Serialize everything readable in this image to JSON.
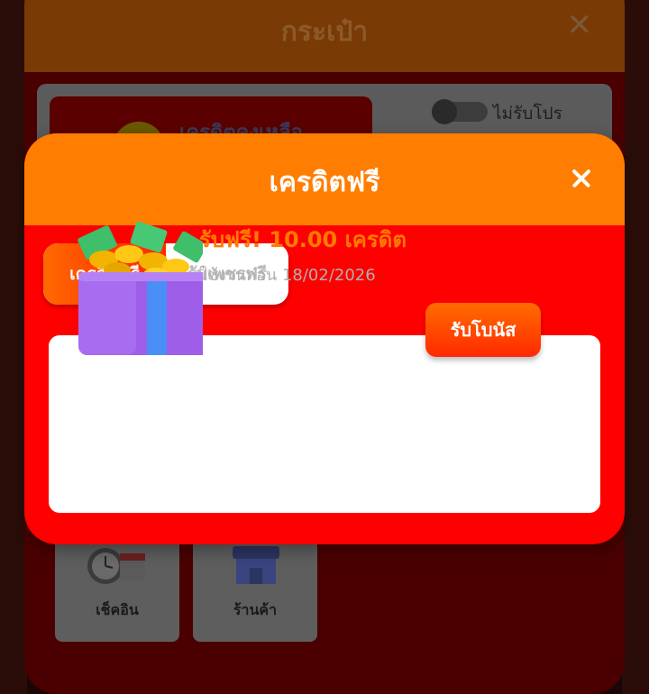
{
  "background_screen": {
    "title": "กระเป๋า",
    "close_icon": "close-icon",
    "credit_label": "เครดิตคงเหลือ",
    "promo_toggle_label": "ไม่รับโปร",
    "menu": [
      {
        "label": "เช็คอิน",
        "icon": "calendar-clock-icon"
      },
      {
        "label": "ร้านค้า",
        "icon": "shop-icon"
      }
    ]
  },
  "modal": {
    "title": "เครดิตฟรี",
    "close_icon": "close-icon",
    "tabs": [
      {
        "label": "เครดิตฟรี",
        "active": true
      },
      {
        "label": "รับเพชรฟรี",
        "active": false
      }
    ],
    "bonus": {
      "title": "รับฟรี! 10.00 เครดิต",
      "expiry": "ใช้งานก่อน 18/02/2026",
      "button_label": "รับโบนัส",
      "icon": "gift-box-icon"
    }
  },
  "colors": {
    "header_orange": "#ff7d00",
    "modal_red": "#ff0000",
    "accent_text": "#ff7a00"
  }
}
